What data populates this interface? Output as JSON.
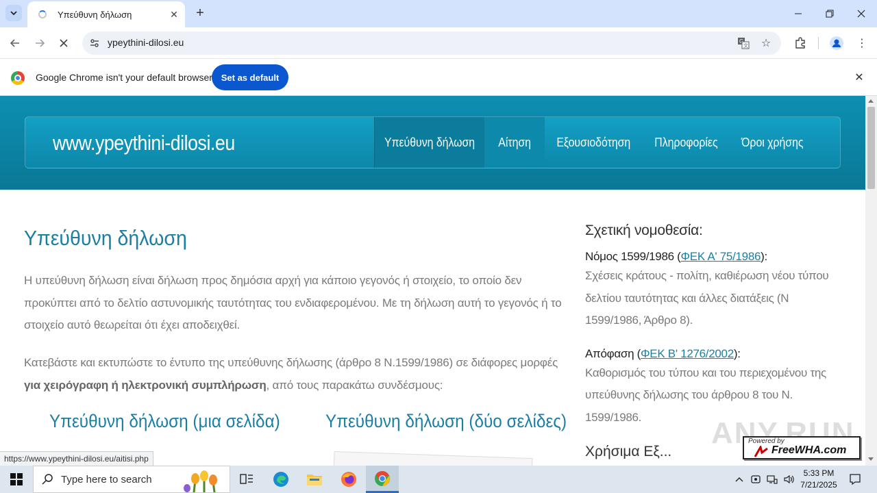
{
  "browser": {
    "tab_title": "Υπεύθυνη δήλωση",
    "url": "ypeythini-dilosi.eu",
    "infobar_message": "Google Chrome isn't your default browser",
    "infobar_button": "Set as default",
    "status_url": "https://www.ypeythini-dilosi.eu/aitisi.php"
  },
  "site": {
    "brand": "www.ypeythini-dilosi.eu",
    "nav": [
      {
        "label": "Υπεύθυνη δήλωση"
      },
      {
        "label": "Αίτηση"
      },
      {
        "label": "Εξουσιοδότηση"
      },
      {
        "label": "Πληροφορίες"
      },
      {
        "label": "Όροι χρήσης"
      }
    ]
  },
  "content": {
    "title": "Υπεύθυνη δήλωση",
    "para1": "Η υπεύθυνη δήλωση είναι δήλωση προς δημόσια αρχή για κάποιο γεγονός ή στοιχείο, το οποίο δεν προκύπτει από το δελτίο αστυνομικής ταυτότητας του ενδιαφερομένου. Με τη δήλωση αυτή το γεγονός ή το στοιχείο αυτό θεωρείται ότι έχει αποδειχθεί.",
    "para2_start": "Κατεβάστε και εκτυπώστε το έντυπο της υπεύθυνης δήλωσης (άρθρο 8 Ν.1599/1986) σε διάφορες μορφές ",
    "para2_bold": "για χειρόγραφη ή ηλεκτρονική συμπλήρωση",
    "para2_end": ", από τους παρακάτω συνδέσμους:",
    "link_one_page": "Υπεύθυνη δήλωση (μια σελίδα)",
    "link_two_pages": "Υπεύθυνη δήλωση (δύο σελίδες)"
  },
  "sidebar": {
    "heading": "Σχετική νομοθεσία:",
    "law1_prefix": "Νόμος 1599/1986 (",
    "law1_link": "ΦΕΚ Α' 75/1986",
    "law1_suffix": "):",
    "law1_desc": "Σχέσεις κράτους - πολίτη, καθιέρωση νέου τύπου δελτίου ταυτότητας και άλλες διατάξεις (Ν 1599/1986, Άρθρο 8).",
    "law2_prefix": "Απόφαση (",
    "law2_link": "ΦΕΚ Β' 1276/2002",
    "law2_suffix": "):",
    "law2_desc": "Καθορισμός του τύπου και του περιεχομένου της υπεύθυνης δήλωσης του άρθρου 8 του Ν. 1599/1986.",
    "next_heading_cut": "Χρήσιμα Εξ..."
  },
  "overlay": {
    "watermark": "ANY.RUN",
    "badge_small": "Powered by",
    "badge_text": "FreeWHA.com"
  },
  "taskbar": {
    "search_placeholder": "Type here to search",
    "time": "5:33 PM",
    "date": "7/21/2025"
  }
}
